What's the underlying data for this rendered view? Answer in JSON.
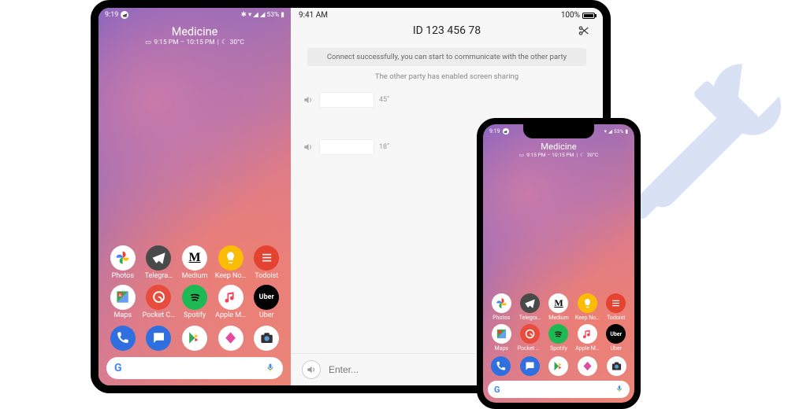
{
  "android": {
    "status": {
      "time": "9:19",
      "battery": "53%"
    },
    "widget": {
      "title": "Medicine",
      "time_range": "9:15 PM – 10:15 PM",
      "temp": "30°C"
    },
    "apps": [
      {
        "id": "photos",
        "label": "Photos"
      },
      {
        "id": "telegram",
        "label": "Telegra…"
      },
      {
        "id": "medium",
        "label": "Medium"
      },
      {
        "id": "keep",
        "label": "Keep No…"
      },
      {
        "id": "todoist",
        "label": "Todoist"
      },
      {
        "id": "maps",
        "label": "Maps"
      },
      {
        "id": "pocket",
        "label": "Pocket C…"
      },
      {
        "id": "spotify",
        "label": "Spotify"
      },
      {
        "id": "applem",
        "label": "Apple M…"
      },
      {
        "id": "uber",
        "label": "Uber"
      }
    ],
    "dock": [
      {
        "id": "phone"
      },
      {
        "id": "msg"
      },
      {
        "id": "play"
      },
      {
        "id": "unk"
      },
      {
        "id": "cam"
      }
    ]
  },
  "chat": {
    "status_time": "9:41 AM",
    "status_batt": "100%",
    "session_id": "ID 123 456 78",
    "banner": "Connect successfully, you can start to communicate with the other party",
    "subnote": "The other party has enabled screen sharing",
    "messages": [
      {
        "duration": "45″"
      },
      {
        "duration": "18″"
      }
    ],
    "input_placeholder": "Enter..."
  }
}
